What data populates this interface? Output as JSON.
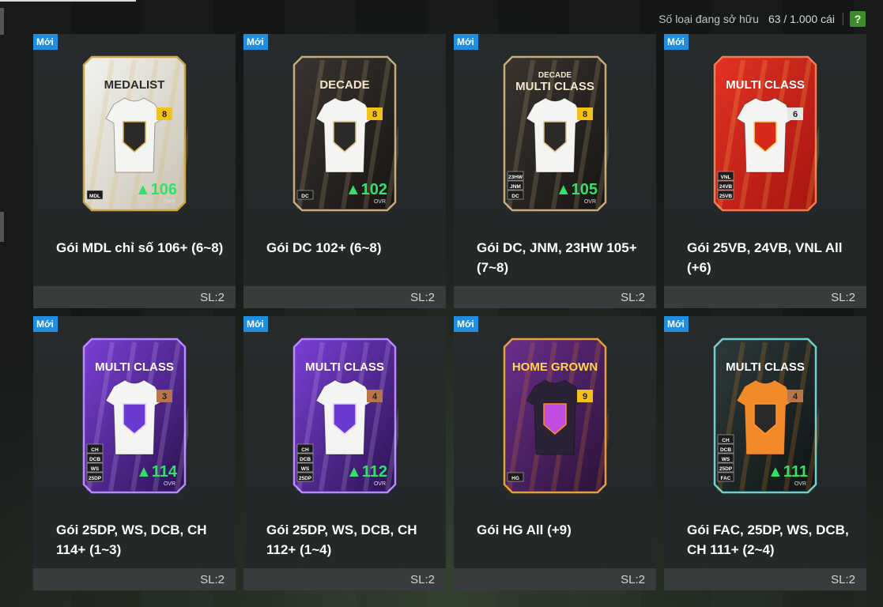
{
  "header": {
    "owned_label": "Số loại đang sở hữu",
    "owned_count": "63 / 1.000 cái",
    "help_label": "?"
  },
  "colors": {
    "badge": "#1f8de0",
    "help": "#3f8a2c",
    "ovr_green": "#33e06a"
  },
  "packs": [
    {
      "badge": "Mới",
      "name": "Gói MDL chỉ số 106+ (6~8)",
      "qty": "SL:2",
      "art": {
        "title": "MEDALIST",
        "grade": "8",
        "ovr": "106",
        "ovr_label": "OVR",
        "tags": [
          "MDL"
        ],
        "theme": "medalist"
      }
    },
    {
      "badge": "Mới",
      "name": "Gói DC 102+ (6~8)",
      "qty": "SL:2",
      "art": {
        "title": "DECADE",
        "grade": "8",
        "ovr": "102",
        "ovr_label": "OVR",
        "tags": [
          "DC"
        ],
        "theme": "decade"
      }
    },
    {
      "badge": "Mới",
      "name": "Gói DC, JNM, 23HW 105+ (7~8)",
      "qty": "SL:2",
      "art": {
        "title": "MULTI CLASS",
        "subtitle": "DECADE",
        "grade": "8",
        "ovr": "105",
        "ovr_label": "OVR",
        "tags": [
          "23HW",
          "JNM",
          "DC"
        ],
        "theme": "decade"
      }
    },
    {
      "badge": "Mới",
      "name": "Gói 25VB, 24VB, VNL All (+6)",
      "qty": "SL:2",
      "art": {
        "title": "MULTI CLASS",
        "grade": "6",
        "ovr": "",
        "ovr_label": "",
        "tags": [
          "VNL",
          "24VB",
          "25VB"
        ],
        "theme": "red"
      }
    },
    {
      "badge": "Mới",
      "name": "Gói 25DP, WS, DCB, CH 114+ (1~3)",
      "qty": "SL:2",
      "art": {
        "title": "MULTI CLASS",
        "grade": "3",
        "ovr": "114",
        "ovr_label": "OVR",
        "tags": [
          "CH",
          "DCB",
          "WS",
          "25DP"
        ],
        "theme": "purple"
      }
    },
    {
      "badge": "Mới",
      "name": "Gói 25DP, WS, DCB, CH 112+ (1~4)",
      "qty": "SL:2",
      "art": {
        "title": "MULTI CLASS",
        "grade": "4",
        "ovr": "112",
        "ovr_label": "OVR",
        "tags": [
          "CH",
          "DCB",
          "WS",
          "25DP"
        ],
        "theme": "purple"
      }
    },
    {
      "badge": "Mới",
      "name": "Gói HG All (+9)",
      "qty": "SL:2",
      "art": {
        "title": "HOME GROWN",
        "grade": "9",
        "ovr": "",
        "ovr_label": "",
        "tags": [
          "HG"
        ],
        "theme": "homegrown"
      }
    },
    {
      "badge": "Mới",
      "name": "Gói FAC, 25DP, WS, DCB, CH 111+ (2~4)",
      "qty": "SL:2",
      "art": {
        "title": "MULTI CLASS",
        "grade": "4",
        "ovr": "111",
        "ovr_label": "OVR",
        "tags": [
          "CH",
          "DCB",
          "WS",
          "25DP",
          "FAC"
        ],
        "theme": "fac"
      }
    }
  ]
}
